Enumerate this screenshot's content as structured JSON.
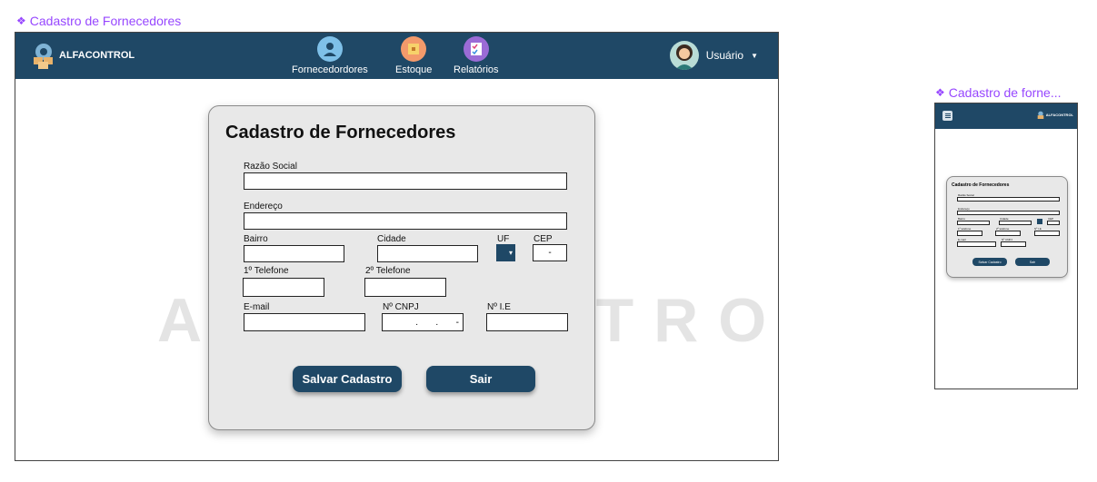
{
  "desktop": {
    "frame_title": "Cadastro de Fornecedores",
    "brand": "ALFACONTROL",
    "nav": [
      {
        "label": "Fornecedordores",
        "icon": "supplier-icon"
      },
      {
        "label": "Estoque",
        "icon": "box-icon"
      },
      {
        "label": "Relatórios",
        "icon": "checklist-icon"
      }
    ],
    "user_label": "Usuário",
    "watermark": "ALFACONTROL",
    "form": {
      "title": "Cadastro de Fornecedores",
      "labels": {
        "razao": "Razão Social",
        "endereco": "Endereço",
        "bairro": "Bairro",
        "cidade": "Cidade",
        "uf": "UF",
        "cep": "CEP",
        "tel1": "1º Telefone",
        "tel2": "2º Telefone",
        "email": "E-mail",
        "cnpj": "Nº CNPJ",
        "ie": "Nº I.E"
      },
      "values": {
        "cep_mask": "-",
        "cnpj_mask": ".       .       -"
      },
      "buttons": {
        "save": "Salvar Cadastro",
        "exit": "Sair"
      }
    }
  },
  "mobile": {
    "frame_title": "Cadastro de forne...",
    "brand": "ALFACONTROL",
    "form": {
      "title": "Cadastro de Fornecedores",
      "labels": {
        "razao": "Razão Social",
        "endereco": "Endereço",
        "bairro": "Bairro",
        "cidade": "Cidade",
        "cep": "CEP",
        "tel1": "1º telefone",
        "tel2": "2º telefone",
        "ie": "Nº I.E",
        "email": "E-mail",
        "cnpj": "Nº CNPJ"
      },
      "buttons": {
        "save": "Salvar Cadastro",
        "exit": "Sair"
      }
    }
  },
  "colors": {
    "navbar": "#1f4866",
    "frame_label": "#9747ff",
    "card": "#e8e8e8"
  }
}
